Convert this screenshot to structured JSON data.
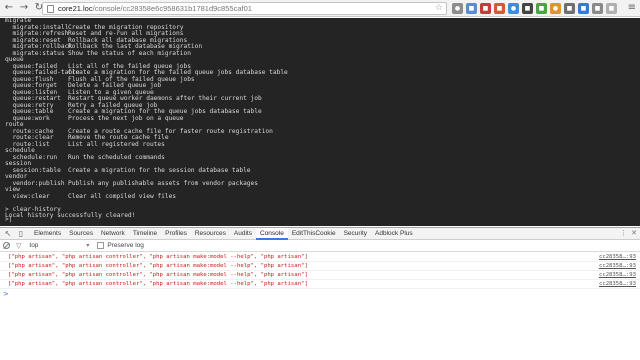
{
  "browser": {
    "url_host": "core21.loc",
    "url_path": "/console/cc28358e6c958631b1781d9c855caf01",
    "back_glyph": "←",
    "forward_glyph": "→",
    "reload_glyph": "↻",
    "star_glyph": "☆",
    "menu_glyph": "≡",
    "extensions": [
      {
        "name": "ext-1",
        "color": "#8d8d8d",
        "glyph": "●"
      },
      {
        "name": "ext-2",
        "color": "#5b8bd6",
        "glyph": "■"
      },
      {
        "name": "ext-3",
        "color": "#c43c3c",
        "glyph": "■"
      },
      {
        "name": "ext-4",
        "color": "#d65b2a",
        "glyph": "■"
      },
      {
        "name": "ext-5",
        "color": "#3a8ee0",
        "glyph": "●"
      },
      {
        "name": "ext-6",
        "color": "#444444",
        "glyph": "■"
      },
      {
        "name": "ext-7",
        "color": "#4aa24a",
        "glyph": "■"
      },
      {
        "name": "ext-8",
        "color": "#e0952a",
        "glyph": "●"
      },
      {
        "name": "ext-9",
        "color": "#6f6f6f",
        "glyph": "■"
      },
      {
        "name": "ext-10",
        "color": "#2f7dd6",
        "glyph": "■"
      },
      {
        "name": "ext-11",
        "color": "#8a8a8a",
        "glyph": "■"
      },
      {
        "name": "ext-12",
        "color": "#b0b0b0",
        "glyph": "■"
      }
    ]
  },
  "terminal": {
    "lines": [
      {
        "cmd": "migrate",
        "desc": ""
      },
      {
        "cmd": "  migrate:install",
        "desc": "Create the migration repository"
      },
      {
        "cmd": "  migrate:refresh",
        "desc": "Reset and re-run all migrations"
      },
      {
        "cmd": "  migrate:reset",
        "desc": "Rollback all database migrations"
      },
      {
        "cmd": "  migrate:rollback",
        "desc": "Rollback the last database migration"
      },
      {
        "cmd": "  migrate:status",
        "desc": "Show the status of each migration"
      },
      {
        "cmd": "queue",
        "desc": ""
      },
      {
        "cmd": "  queue:failed",
        "desc": "List all of the failed queue jobs"
      },
      {
        "cmd": "  queue:failed-table",
        "desc": "Create a migration for the failed queue jobs database table"
      },
      {
        "cmd": "  queue:flush",
        "desc": "Flush all of the failed queue jobs"
      },
      {
        "cmd": "  queue:forget",
        "desc": "Delete a failed queue job"
      },
      {
        "cmd": "  queue:listen",
        "desc": "Listen to a given queue"
      },
      {
        "cmd": "  queue:restart",
        "desc": "Restart queue worker daemons after their current job"
      },
      {
        "cmd": "  queue:retry",
        "desc": "Retry a failed queue job"
      },
      {
        "cmd": "  queue:table",
        "desc": "Create a migration for the queue jobs database table"
      },
      {
        "cmd": "  queue:work",
        "desc": "Process the next job on a queue"
      },
      {
        "cmd": "route",
        "desc": ""
      },
      {
        "cmd": "  route:cache",
        "desc": "Create a route cache file for faster route registration"
      },
      {
        "cmd": "  route:clear",
        "desc": "Remove the route cache file"
      },
      {
        "cmd": "  route:list",
        "desc": "List all registered routes"
      },
      {
        "cmd": "schedule",
        "desc": ""
      },
      {
        "cmd": "  schedule:run",
        "desc": "Run the scheduled commands"
      },
      {
        "cmd": "session",
        "desc": ""
      },
      {
        "cmd": "  session:table",
        "desc": "Create a migration for the session database table"
      },
      {
        "cmd": "vendor",
        "desc": ""
      },
      {
        "cmd": "  vendor:publish",
        "desc": "Publish any publishable assets from vendor packages"
      },
      {
        "cmd": "view",
        "desc": ""
      },
      {
        "cmd": "  view:clear",
        "desc": "Clear all compiled view files"
      }
    ],
    "after": [
      "> clear-history",
      "Local history successfully cleared!"
    ],
    "prompt": ">|"
  },
  "devtools": {
    "tabs": [
      "Elements",
      "Sources",
      "Network",
      "Timeline",
      "Profiles",
      "Resources",
      "Audits",
      "Console",
      "EditThisCookie",
      "Security",
      "Adblock Plus"
    ],
    "active_tab": "Console",
    "context": "top",
    "preserve_log_label": "Preserve log",
    "messages": [
      {
        "text": "[\"php artisan\", \"php artisan controller\", \"php artisan make:model --help\", \"php artisan\"]",
        "source": "cc28358…:93"
      },
      {
        "text": "[\"php artisan\", \"php artisan controller\", \"php artisan make:model --help\", \"php artisan\"]",
        "source": "cc28358…:93"
      },
      {
        "text": "[\"php artisan\", \"php artisan controller\", \"php artisan make:model --help\", \"php artisan\"]",
        "source": "cc28358…:93"
      },
      {
        "text": "[\"php artisan\", \"php artisan controller\", \"php artisan make:model --help\", \"php artisan\"]",
        "source": "cc28358…:93"
      }
    ],
    "console_prompt": ">"
  }
}
